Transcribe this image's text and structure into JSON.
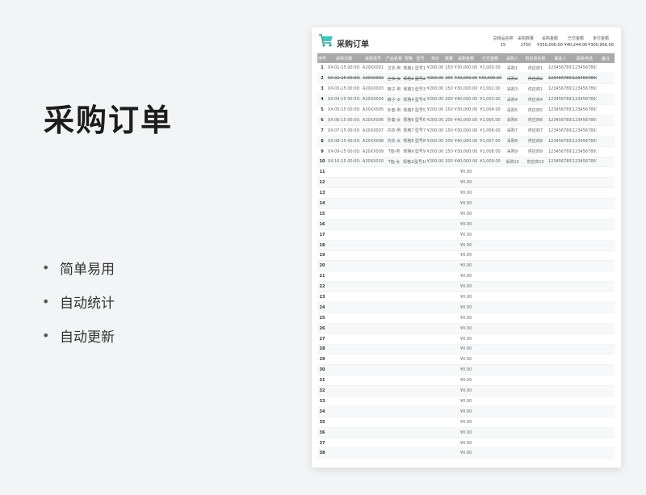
{
  "page": {
    "title": "采购订单",
    "features": [
      "简单易用",
      "自动统计",
      "自动更新"
    ]
  },
  "sheet": {
    "title": "采购订单",
    "stats": [
      {
        "label": "总物品名称",
        "value": "15"
      },
      {
        "label": "采购数量",
        "value": "1750"
      },
      {
        "label": "采购金额",
        "value": "¥350,000.00"
      },
      {
        "label": "已付金额",
        "value": "¥40,244.00"
      },
      {
        "label": "未付金额",
        "value": "¥300,956.00"
      }
    ],
    "headers": [
      "序号",
      "采购日期",
      "采购单号",
      "产品名称",
      "规格",
      "型号",
      "单价",
      "数量",
      "采购金额",
      "已付金额",
      "采购人",
      "供应商名称",
      "联系人",
      "联系电话",
      "备注"
    ],
    "rows": [
      [
        "1",
        "XX-01-15 00:00:",
        "A20XX001",
        "卫衣-男",
        "规格1",
        "型号1",
        "¥200.00",
        "150",
        "¥30,000.00",
        "¥1,000.00",
        "采购1",
        "供应商1",
        "12345678910",
        "12345678910",
        ""
      ],
      [
        "2",
        "XX-02-15 00:00:",
        "A20XX002",
        "卫衣-女",
        "规格2",
        "型号2",
        "¥200.00",
        "200",
        "¥40,000.00",
        "¥40,000.00",
        "采购2",
        "供应商2",
        "12345678911",
        "12345678911",
        ""
      ],
      [
        "3",
        "XX-03-15 00:00:",
        "A20XX003",
        "裤子-男",
        "规格3",
        "型号3",
        "¥200.00",
        "150",
        "¥30,000.00",
        "¥1,002.00",
        "采购3",
        "供应商1",
        "12345678912",
        "12345678912",
        ""
      ],
      [
        "4",
        "XX-04-15 00:00:",
        "A20XX004",
        "裤子-女",
        "规格4",
        "型号4",
        "¥200.00",
        "200",
        "¥40,000.00",
        "¥1,003.00",
        "采购4",
        "供应商4",
        "12345678913",
        "12345678913",
        ""
      ],
      [
        "5",
        "XX-05-15 00:00:",
        "A20XX005",
        "外套-男",
        "规格5",
        "型号5",
        "¥200.00",
        "150",
        "¥30,000.00",
        "¥1,004.00",
        "采购5",
        "供应商5",
        "12345678914",
        "12345678914",
        ""
      ],
      [
        "6",
        "XX-06-15 00:00:",
        "A20XX006",
        "外套-女",
        "规格6",
        "型号6",
        "¥200.00",
        "200",
        "¥40,000.00",
        "¥1,005.00",
        "采购6",
        "供应商6",
        "12345678915",
        "12345678915",
        ""
      ],
      [
        "7",
        "XX-07-15 00:00:",
        "A20XX007",
        "内衣-男",
        "规格7",
        "型号7",
        "¥200.00",
        "150",
        "¥30,000.00",
        "¥1,006.00",
        "采购7",
        "供应商7",
        "12345678916",
        "12345678916",
        ""
      ],
      [
        "8",
        "XX-08-15 00:00:",
        "A20XX008",
        "内衣-女",
        "规格8",
        "型号8",
        "¥200.00",
        "200",
        "¥40,000.00",
        "¥1,007.00",
        "采购8",
        "供应商8",
        "12345678917",
        "12345678917",
        ""
      ],
      [
        "9",
        "XX-09-15 00:00:",
        "A20XX009",
        "T恤-男",
        "规格9",
        "型号9",
        "¥200.00",
        "150",
        "¥30,000.00",
        "¥1,008.00",
        "采购9",
        "供应商9",
        "12345678918",
        "12345678918",
        ""
      ],
      [
        "10",
        "XX-10-15 00:00:",
        "A20XX010",
        "T恤-女",
        "规格10",
        "型号10",
        "¥200.00",
        "200",
        "¥40,000.00",
        "¥1,009.00",
        "采购10",
        "供应商10",
        "12345678919",
        "12345678919",
        ""
      ]
    ],
    "strike_row": 2,
    "empty_row_amount": "¥0.00",
    "empty_row_numbers": [
      "11",
      "12",
      "13",
      "14",
      "15",
      "16",
      "17",
      "18",
      "19",
      "20",
      "21",
      "22",
      "23",
      "24",
      "25",
      "26",
      "27",
      "28",
      "29",
      "30",
      "31",
      "32",
      "33",
      "34",
      "35",
      "36",
      "37",
      "38"
    ]
  }
}
